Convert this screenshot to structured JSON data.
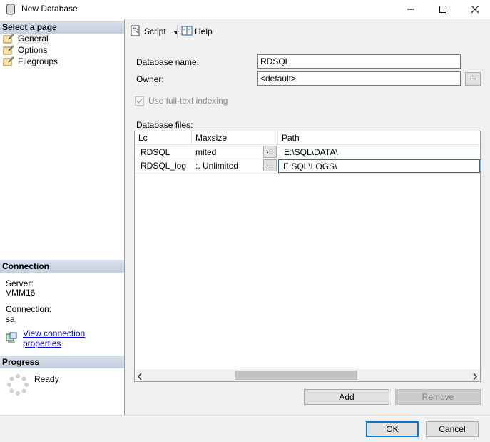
{
  "window": {
    "title": "New Database"
  },
  "left_pane": {
    "select_page_header": "Select a page",
    "pages": [
      {
        "label": "General",
        "icon": "wrench-page-icon",
        "selected": true
      },
      {
        "label": "Options",
        "icon": "wrench-page-icon",
        "selected": false
      },
      {
        "label": "Filegroups",
        "icon": "wrench-page-icon",
        "selected": false
      }
    ],
    "connection_header": "Connection",
    "server_label": "Server:",
    "server_value": "VMM16",
    "connection_label": "Connection:",
    "connection_value": "sa",
    "view_connection_link": "View connection properties",
    "progress_header": "Progress",
    "progress_status": "Ready"
  },
  "toolbar": {
    "script_label": "Script",
    "help_label": "Help"
  },
  "form": {
    "database_name_label": "Database name:",
    "database_name_value": "RDSQL",
    "owner_label": "Owner:",
    "owner_value": "<default>",
    "owner_browse": "...",
    "fulltext_label": "Use full-text indexing",
    "database_files_label": "Database files:"
  },
  "files_grid": {
    "columns": [
      "Lc",
      "Maxsize",
      "Path"
    ],
    "rows": [
      {
        "logical": "RDSQL",
        "maxsize": "mited",
        "browse": "...",
        "path": "E:\\SQL\\DATA\\"
      },
      {
        "logical": "RDSQL_log",
        "maxsize": ":. Unlimited",
        "browse": "...",
        "path": "E:SQL\\LOGS\\"
      }
    ]
  },
  "buttons": {
    "add": "Add",
    "remove": "Remove",
    "ok": "OK",
    "cancel": "Cancel"
  },
  "colors": {
    "accent": "#0078d7",
    "header_band": "#c8d3e2",
    "link": "#0000ee"
  }
}
